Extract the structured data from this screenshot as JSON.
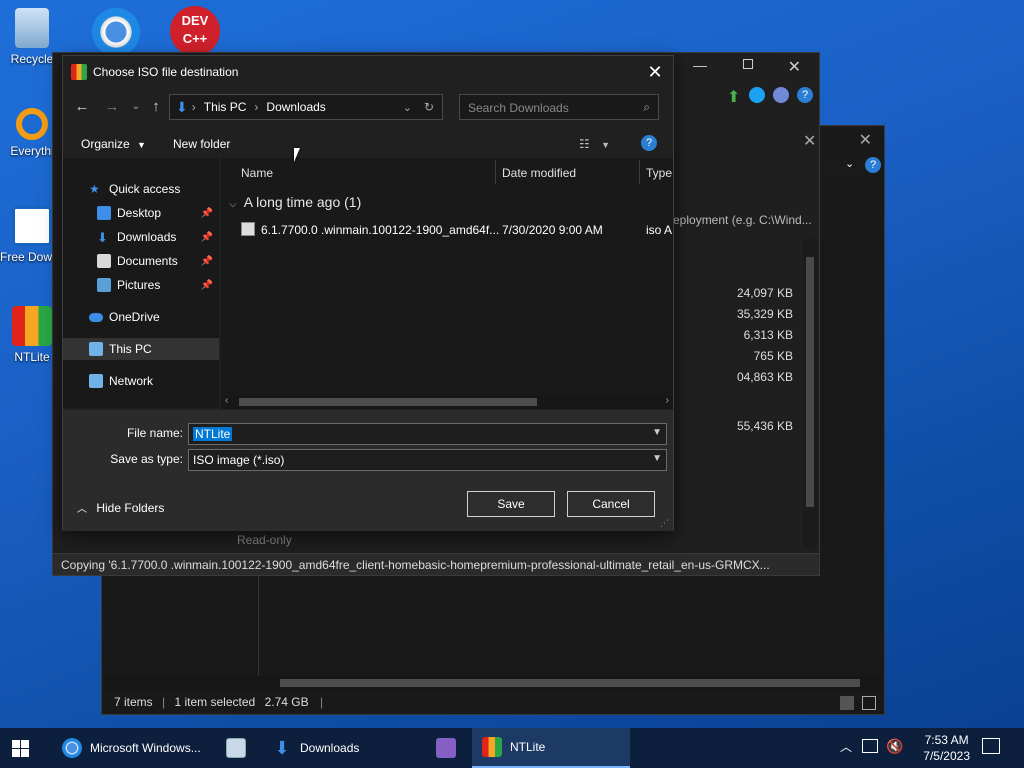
{
  "desktop": {
    "icons": [
      {
        "label": "Recycle"
      },
      {
        "label": "Everythi"
      },
      {
        "label": "Free Downlo"
      },
      {
        "label": "NTLite"
      }
    ],
    "chrome_icon_label": "",
    "devcpp_label": "DEV C++"
  },
  "ntlite": {
    "status_text": "Copying '6.1.7700.0 .winmain.100122-1900_amd64fre_client-homebasic-homepremium-professional-ultimate_retail_en-us-GRMCX...",
    "sizes": [
      "24,097 KB",
      "35,329 KB",
      "6,313 KB",
      "765 KB",
      "04,863 KB",
      "55,436 KB"
    ],
    "path_hint": "eployment (e.g. C:\\Wind...",
    "readonly_label": "Read-only"
  },
  "explorer": {
    "status_items": "7 items",
    "status_selected": "1 item selected",
    "status_size": "2.74 GB"
  },
  "dialog": {
    "title": "Choose ISO file destination",
    "breadcrumb": [
      "This PC",
      "Downloads"
    ],
    "search_placeholder": "Search Downloads",
    "organize_label": "Organize",
    "new_folder_label": "New folder",
    "nav": {
      "quick_access": "Quick access",
      "desktop": "Desktop",
      "downloads": "Downloads",
      "documents": "Documents",
      "pictures": "Pictures",
      "onedrive": "OneDrive",
      "this_pc": "This PC",
      "network": "Network"
    },
    "columns": {
      "name": "Name",
      "date": "Date modified",
      "type": "Type"
    },
    "group_label": "A long time ago (1)",
    "files": [
      {
        "name": "6.1.7700.0 .winmain.100122-1900_amd64f...",
        "date": "7/30/2020 9:00 AM",
        "type": "iso A"
      }
    ],
    "file_name_label": "File name:",
    "file_name_value": "NTLite",
    "save_type_label": "Save as type:",
    "save_type_value": "ISO image (*.iso)",
    "hide_folders_label": "Hide Folders",
    "save_label": "Save",
    "cancel_label": "Cancel"
  },
  "taskbar": {
    "items": [
      {
        "label": "Microsoft Windows..."
      },
      {
        "label": ""
      },
      {
        "label": "Downloads"
      },
      {
        "label": ""
      },
      {
        "label": "NTLite"
      }
    ],
    "time": "7:53 AM",
    "date": "7/5/2023"
  },
  "colors": {
    "accent": "#0078d4",
    "desktop_bg": "#1a5fc4",
    "dark_window": "#202020"
  }
}
